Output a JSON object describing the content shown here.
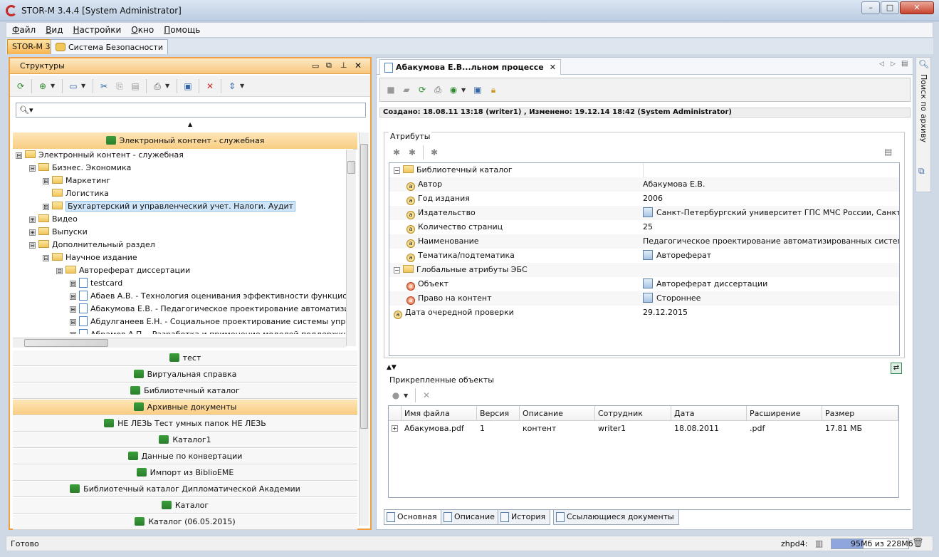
{
  "window": {
    "title": "STOR-M 3.4.4 [System Administrator]"
  },
  "menu": [
    "Файл",
    "Вид",
    "Настройки",
    "Окно",
    "Помощь"
  ],
  "perspectives": [
    "STOR-M 3",
    "Система Безопасности"
  ],
  "left_panel": {
    "title": "Структуры",
    "search_placeholder": "",
    "active_group": "Электронный контент - служебная",
    "tree": [
      {
        "label": "Электронный контент - служебная",
        "level": 0,
        "expander": "⊟",
        "icon": "folder"
      },
      {
        "label": "Бизнес. Экономика",
        "level": 1,
        "expander": "⊟",
        "icon": "folder"
      },
      {
        "label": "Маркетинг",
        "level": 2,
        "expander": "⊞",
        "icon": "folder"
      },
      {
        "label": "Логистика",
        "level": 2,
        "expander": "",
        "icon": "folder"
      },
      {
        "label": "Бухгартерский и управленческий учет. Налоги. Аудит",
        "level": 2,
        "expander": "⊞",
        "icon": "folder",
        "selected": true
      },
      {
        "label": "Видео",
        "level": 1,
        "expander": "⊞",
        "icon": "folder"
      },
      {
        "label": "Выпуски",
        "level": 1,
        "expander": "⊞",
        "icon": "folder"
      },
      {
        "label": "Дополнительный раздел",
        "level": 1,
        "expander": "⊟",
        "icon": "folder"
      },
      {
        "label": "Научное издание",
        "level": 2,
        "expander": "⊟",
        "icon": "folder"
      },
      {
        "label": "Автореферат диссертации",
        "level": 3,
        "expander": "⊟",
        "icon": "folder"
      },
      {
        "label": "testcard",
        "level": 4,
        "expander": "⊞",
        "icon": "doc"
      },
      {
        "label": "Абаев А.В. - Технология оценивания эффективности функционирования",
        "level": 4,
        "expander": "⊞",
        "icon": "doc"
      },
      {
        "label": "Абакумова Е.В. - Педагогическое проектирование автоматизированных",
        "level": 4,
        "expander": "⊞",
        "icon": "doc"
      },
      {
        "label": "Абдулганеев Е.Н. - Социальное проектирование системы управления",
        "level": 4,
        "expander": "⊞",
        "icon": "doc"
      },
      {
        "label": "Абрамов А.П. - Разработка и применение моделей поддержки управления",
        "level": 4,
        "expander": "⊞",
        "icon": "doc"
      }
    ],
    "groups": [
      {
        "label": "тест",
        "selected": false
      },
      {
        "label": "Виртуальная справка",
        "selected": false
      },
      {
        "label": "Библиотечный каталог",
        "selected": false
      },
      {
        "label": "Архивные документы",
        "selected": true
      },
      {
        "label": "НЕ ЛЕЗЬ Тест умных папок НЕ ЛЕЗЬ",
        "selected": false
      },
      {
        "label": "Каталог1",
        "selected": false
      },
      {
        "label": "Данные по конвертации",
        "selected": false
      },
      {
        "label": "Импорт из BiblioEME",
        "selected": false
      },
      {
        "label": "Библиотечный каталог Дипломатической Академии",
        "selected": false
      },
      {
        "label": "Каталог",
        "selected": false
      },
      {
        "label": "Каталог (06.05.2015)",
        "selected": false
      }
    ]
  },
  "editor": {
    "tab_title": "Абакумова Е.В...льном процессе",
    "info_line": "Создано: 18.08.11 13:18 (writer1) , Изменено: 19.12.14 18:42 (System Administrator)",
    "attributes_label": "Атрибуты",
    "attributes": [
      {
        "name": "Библиотечный каталог",
        "value": "",
        "kind": "group",
        "level": 0
      },
      {
        "name": "Автор",
        "value": "Абакумова Е.В.",
        "kind": "attr",
        "level": 1
      },
      {
        "name": "Год издания",
        "value": "2006",
        "kind": "attr",
        "level": 1
      },
      {
        "name": "Издательство",
        "value": "Санкт-Петербургский университет ГПС МЧС России, Санкт-Пе...",
        "kind": "attr",
        "level": 1,
        "ref": true
      },
      {
        "name": "Количество страниц",
        "value": "25",
        "kind": "attr",
        "level": 1
      },
      {
        "name": "Наименование",
        "value": "Педагогическое проектирование автоматизированных систем упр...",
        "kind": "attr",
        "level": 1
      },
      {
        "name": "Тематика/подтематика",
        "value": "Автореферат",
        "kind": "attr",
        "level": 1,
        "ref": true
      },
      {
        "name": "Глобальные атрибуты ЭБС",
        "value": "",
        "kind": "group",
        "level": 0
      },
      {
        "name": "Объект",
        "value": "Автореферат диссертации",
        "kind": "attr-red",
        "level": 1,
        "ref": true
      },
      {
        "name": "Право на контент",
        "value": "Стороннее",
        "kind": "attr-red",
        "level": 1,
        "ref": true
      },
      {
        "name": "Дата очередной проверки",
        "value": "29.12.2015",
        "kind": "attr",
        "level": 0
      }
    ],
    "attachments_label": "Прикрепленные объекты",
    "attachments_columns": [
      "Имя файла",
      "Версия",
      "Описание",
      "Сотрудник",
      "Дата",
      "Расширение",
      "Размер"
    ],
    "attachments_rows": [
      [
        "Абакумова.pdf",
        "1",
        "контент",
        "writer1",
        "18.08.2011",
        ".pdf",
        "17.81 МБ"
      ]
    ],
    "bottom_tabs": [
      "Основная",
      "Описание",
      "История",
      "Ссылающиеся документы"
    ]
  },
  "side_panel": {
    "label": "Поиск по архиву"
  },
  "status": {
    "text": "Готово",
    "user": "zhpd4:",
    "memory": "95Мб из 228Мб",
    "memory_fraction": 0.42
  }
}
